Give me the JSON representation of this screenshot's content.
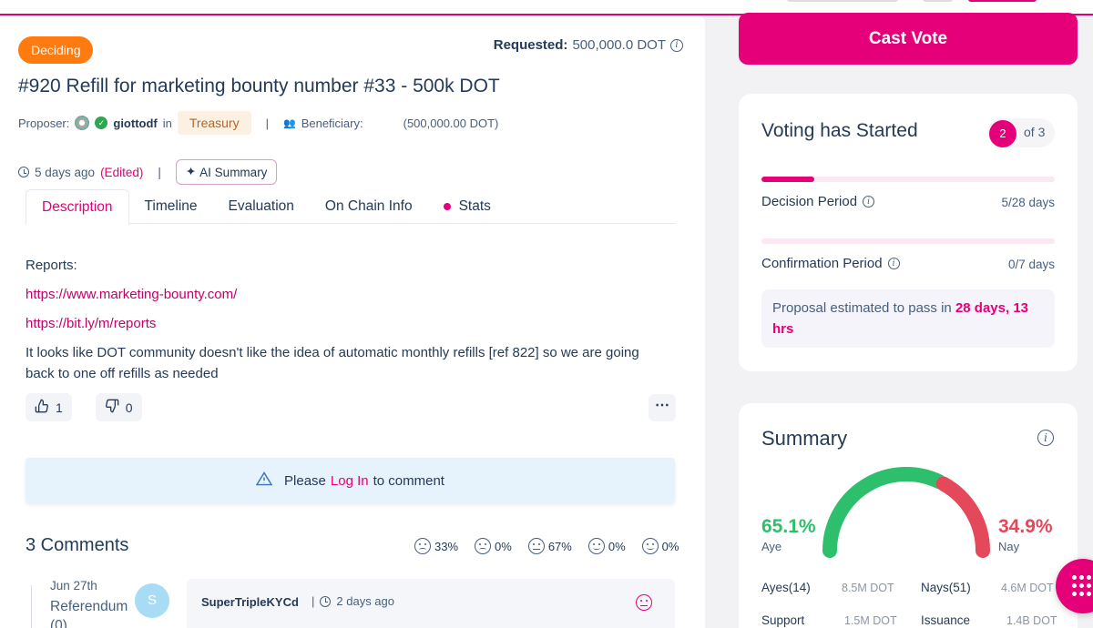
{
  "proposal": {
    "status": "Deciding",
    "requested_label": "Requested:",
    "requested_value": "500,000.0 DOT",
    "title": "#920 Refill for marketing bounty number #33 - 500k DOT",
    "proposer_label": "Proposer:",
    "proposer_name": "giottodf",
    "in_label": "in",
    "track": "Treasury",
    "beneficiary_label": "Beneficiary:",
    "beneficiary_value": "(500,000.00 DOT)",
    "time_ago": "5 days ago",
    "edited": "(Edited)",
    "ai_summary": "AI Summary"
  },
  "tabs": [
    "Description",
    "Timeline",
    "Evaluation",
    "On Chain Info",
    "Stats"
  ],
  "description": {
    "reports_label": "Reports:",
    "link1": "https://www.marketing-bounty.com/",
    "link2": "https://bit.ly/m/reports",
    "body": "It looks like DOT community doesn't like the idea of automatic monthly refills [ref 822] so we are going back to one off refills as needed"
  },
  "reactions": {
    "likes": "1",
    "dislikes": "0"
  },
  "login_prompt": {
    "before": "Please",
    "link": "Log In",
    "after": "to comment"
  },
  "comments": {
    "title": "3 Comments",
    "sentiments": [
      "33%",
      "0%",
      "67%",
      "0%",
      "0%"
    ],
    "timeline_date": "Jun 27th",
    "timeline_ref": "Referendum (0)",
    "first": {
      "avatar_letter": "S",
      "author": "SuperTripleKYCd",
      "time": "2 days ago"
    }
  },
  "cast_vote": "Cast Vote",
  "voting": {
    "title": "Voting has Started",
    "step": "2",
    "step_of": "of 3",
    "decision_label": "Decision Period",
    "decision_value": "5/28 days",
    "decision_progress": 0.18,
    "confirmation_label": "Confirmation Period",
    "confirmation_value": "0/7 days",
    "confirmation_progress": 0,
    "estimate_text": "Proposal estimated to pass in",
    "estimate_bold": "28 days, 13 hrs"
  },
  "summary": {
    "title": "Summary",
    "aye_pct": "65.1%",
    "aye_label": "Aye",
    "nay_pct": "34.9%",
    "nay_label": "Nay",
    "aye_fraction": 0.651,
    "ayes_label": "Ayes(14)",
    "ayes_value": "8.5M DOT",
    "nays_label": "Nays(51)",
    "nays_value": "4.6M DOT",
    "support_label": "Support",
    "support_value": "1.5M DOT",
    "issuance_label": "Issuance",
    "issuance_value": "1.4B DOT"
  },
  "colors": {
    "accent": "#e5007a",
    "aye": "#2dbf6b",
    "nay": "#e4485b",
    "status": "#ff7a0f"
  }
}
